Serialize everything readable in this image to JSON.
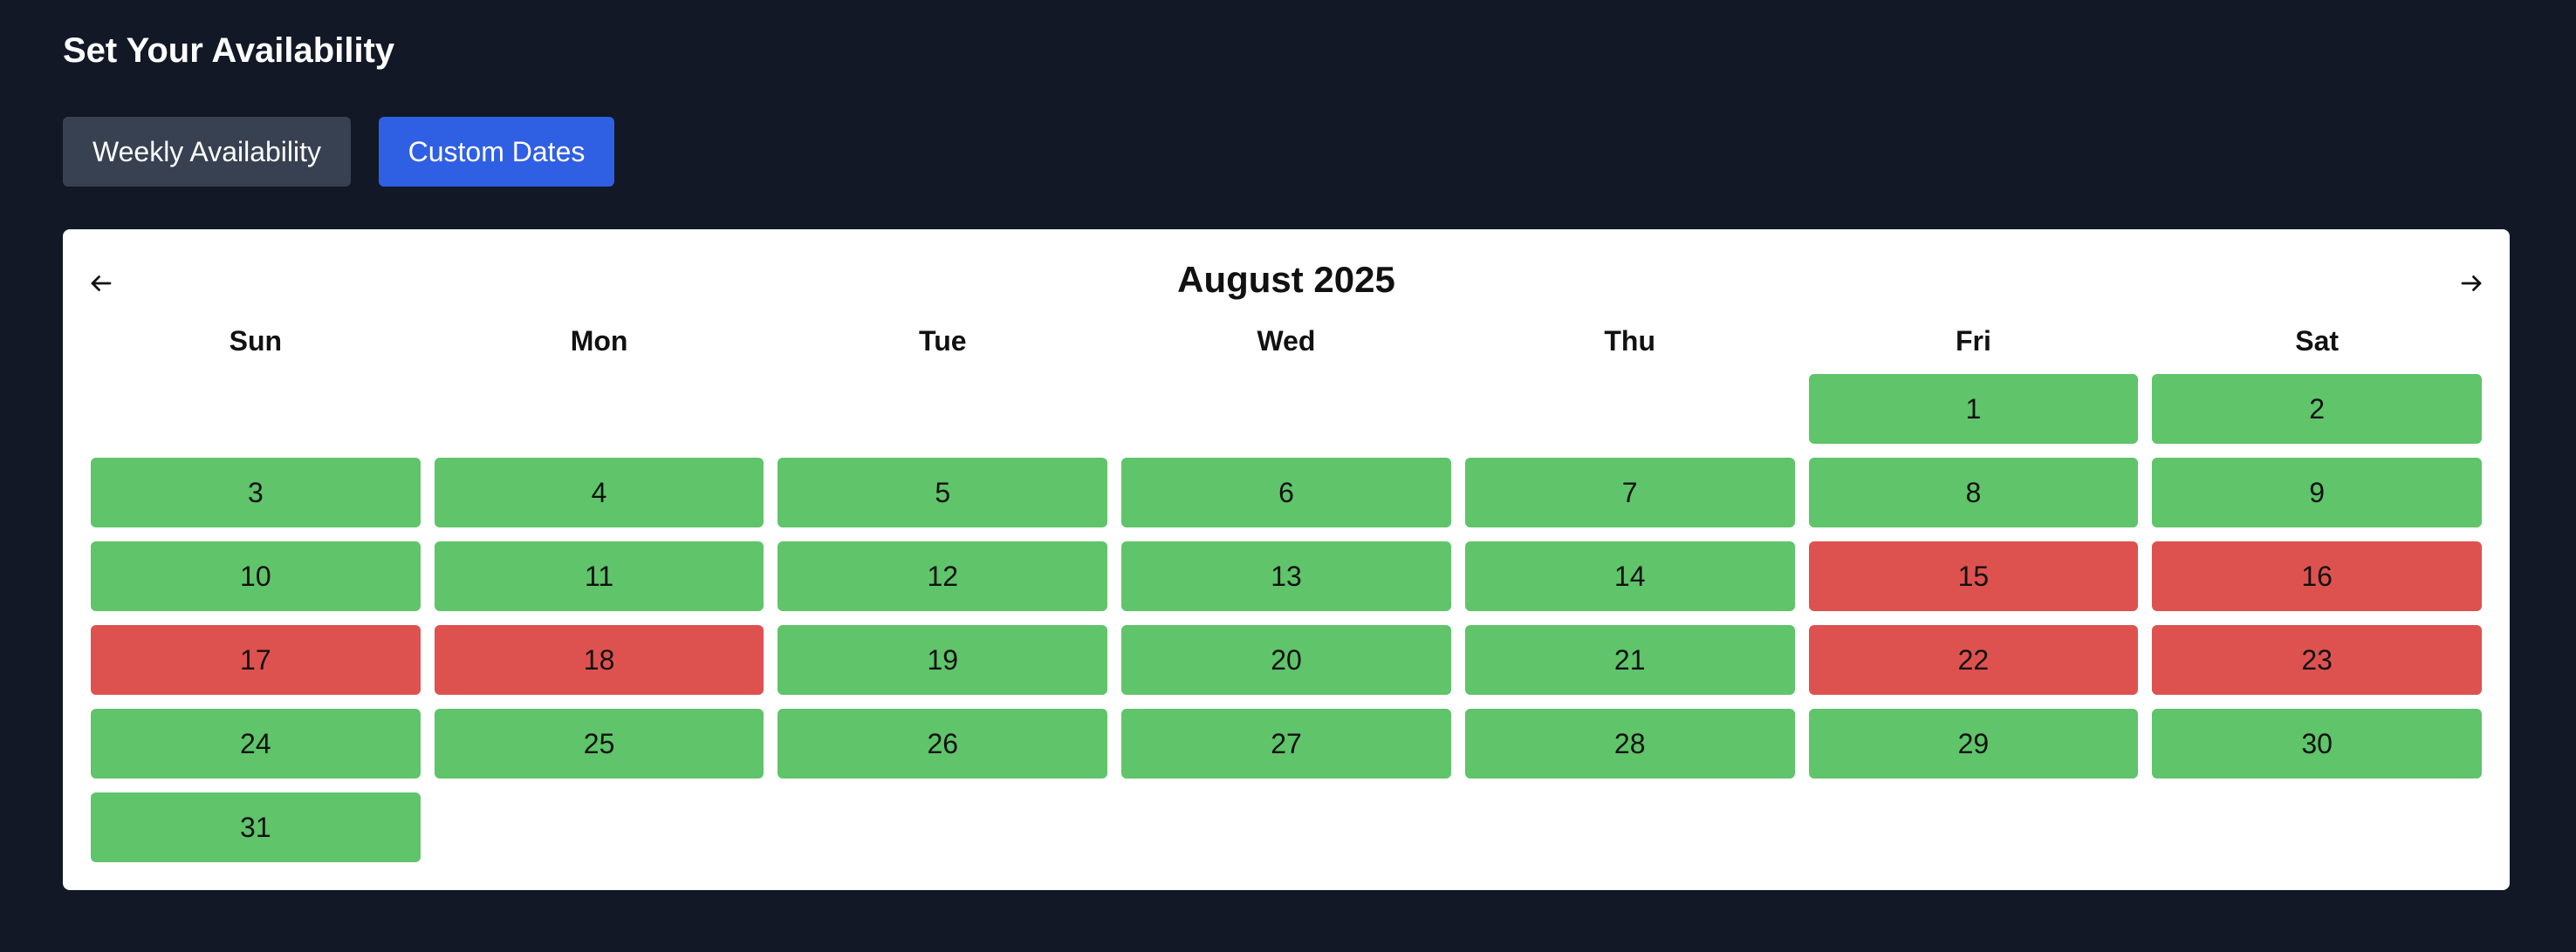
{
  "header": {
    "title": "Set Your Availability"
  },
  "tabs": {
    "weekly_label": "Weekly Availability",
    "custom_label": "Custom Dates",
    "active": "custom"
  },
  "calendar": {
    "month_label": "August 2025",
    "prev_icon": "arrow-left-icon",
    "next_icon": "arrow-right-icon",
    "weekdays": [
      "Sun",
      "Mon",
      "Tue",
      "Wed",
      "Thu",
      "Fri",
      "Sat"
    ],
    "first_weekday_index": 5,
    "days": [
      {
        "day": "1",
        "status": "available"
      },
      {
        "day": "2",
        "status": "available"
      },
      {
        "day": "3",
        "status": "available"
      },
      {
        "day": "4",
        "status": "available"
      },
      {
        "day": "5",
        "status": "available"
      },
      {
        "day": "6",
        "status": "available"
      },
      {
        "day": "7",
        "status": "available"
      },
      {
        "day": "8",
        "status": "available"
      },
      {
        "day": "9",
        "status": "available"
      },
      {
        "day": "10",
        "status": "available"
      },
      {
        "day": "11",
        "status": "available"
      },
      {
        "day": "12",
        "status": "available"
      },
      {
        "day": "13",
        "status": "available"
      },
      {
        "day": "14",
        "status": "available"
      },
      {
        "day": "15",
        "status": "unavailable"
      },
      {
        "day": "16",
        "status": "unavailable"
      },
      {
        "day": "17",
        "status": "unavailable"
      },
      {
        "day": "18",
        "status": "unavailable"
      },
      {
        "day": "19",
        "status": "available"
      },
      {
        "day": "20",
        "status": "available"
      },
      {
        "day": "21",
        "status": "available"
      },
      {
        "day": "22",
        "status": "unavailable"
      },
      {
        "day": "23",
        "status": "unavailable"
      },
      {
        "day": "24",
        "status": "available"
      },
      {
        "day": "25",
        "status": "available"
      },
      {
        "day": "26",
        "status": "available"
      },
      {
        "day": "27",
        "status": "available"
      },
      {
        "day": "28",
        "status": "available"
      },
      {
        "day": "29",
        "status": "available"
      },
      {
        "day": "30",
        "status": "available"
      },
      {
        "day": "31",
        "status": "available"
      }
    ]
  },
  "colors": {
    "background": "#121826",
    "available": "#5fc46a",
    "unavailable": "#dd524f",
    "tab_active": "#2f5fe3",
    "tab_inactive": "#374151"
  }
}
